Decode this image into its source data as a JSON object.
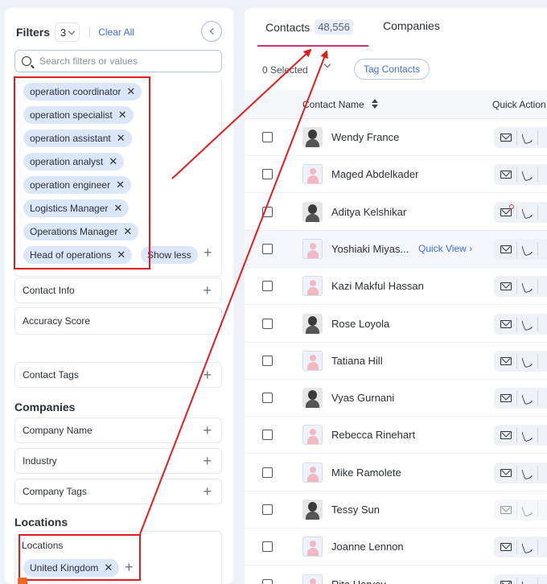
{
  "filters": {
    "title": "Filters",
    "count": "3",
    "clear_all": "Clear All",
    "search_placeholder": "Search filters or values",
    "chips": [
      "operation coordinator",
      "operation specialist",
      "operation assistant",
      "operation analyst",
      "operation engineer",
      "Logistics Manager",
      "Operations Manager",
      "Head of operations"
    ],
    "show_less": "Show less",
    "contact_sections": [
      "Contact Info",
      "Accuracy Score",
      "Contact Tags"
    ],
    "companies_title": "Companies",
    "company_sections": [
      "Company Name",
      "Industry",
      "Company Tags"
    ],
    "locations_title": "Locations",
    "locations_label": "Locations",
    "location_chip": "United Kingdom"
  },
  "main": {
    "tabs": [
      {
        "label": "Contacts",
        "count": "48,556"
      },
      {
        "label": "Companies"
      }
    ],
    "selected_count": "0 Selected",
    "tag_button": "Tag Contacts",
    "columns": {
      "name": "Contact Name",
      "actions": "Quick Action"
    },
    "quick_view": "Quick View ›",
    "rows": [
      {
        "name": "Wendy France",
        "avatar": "photo"
      },
      {
        "name": "Maged Abdelkader",
        "avatar": "default"
      },
      {
        "name": "Aditya Kelshikar",
        "avatar": "photo",
        "mail_alert": true
      },
      {
        "name": "Yoshiaki Miyas...",
        "avatar": "default",
        "highlight": true
      },
      {
        "name": "Kazi Makful Hassan",
        "avatar": "default"
      },
      {
        "name": "Rose Loyola",
        "avatar": "photo"
      },
      {
        "name": "Tatiana Hill",
        "avatar": "default"
      },
      {
        "name": "Vyas Gurnani",
        "avatar": "photo"
      },
      {
        "name": "Rebecca Rinehart",
        "avatar": "default"
      },
      {
        "name": "Mike Ramolete",
        "avatar": "default"
      },
      {
        "name": "Tessy Sun",
        "avatar": "photo",
        "dim_actions": true
      },
      {
        "name": "Joanne Lennon",
        "avatar": "default"
      },
      {
        "name": "Rita Harvey",
        "avatar": "default"
      }
    ]
  },
  "colors": {
    "accent": "#3c6ee0",
    "chip_bg": "#dbe6f8",
    "tab_underline": "#d3326f",
    "annotation": "#e11d1d"
  }
}
